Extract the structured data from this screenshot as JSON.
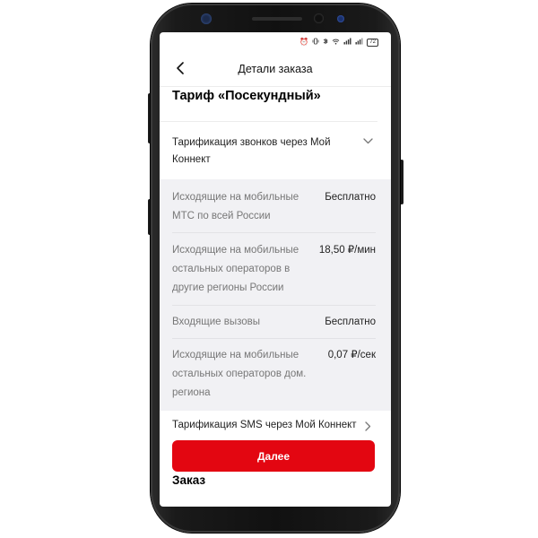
{
  "status_bar": {
    "icons": [
      "alarm-icon",
      "vibrate-icon",
      "bluetooth-icon",
      "wifi-icon",
      "signal-icon",
      "signal-icon"
    ],
    "battery": "72"
  },
  "header": {
    "back_icon": "chevron-left-icon",
    "title": "Детали заказа"
  },
  "tariff": {
    "title": "Тариф «Посекундный»"
  },
  "calls_section": {
    "label": "Тарификация звонков через Мой Коннект",
    "icon": "chevron-down-icon",
    "rows": [
      {
        "label": "Исходящие на мобильные МТС по всей России",
        "value": "Бесплатно"
      },
      {
        "label": "Исходящие на мобильные остальных операторов в другие регионы России",
        "value": "18,50 ₽/мин"
      },
      {
        "label": "Входящие вызовы",
        "value": "Бесплатно"
      },
      {
        "label": "Исходящие на мобильные остальных операторов дом. региона",
        "value": "0,07 ₽/сек"
      }
    ]
  },
  "sms_section": {
    "label": "Тарификация SMS через Мой Коннект",
    "icon": "chevron-right-icon"
  },
  "actions": {
    "next_label": "Далее"
  },
  "order": {
    "heading": "Заказ"
  },
  "colors": {
    "accent": "#e30611",
    "panel_bg": "#f1f1f4"
  }
}
